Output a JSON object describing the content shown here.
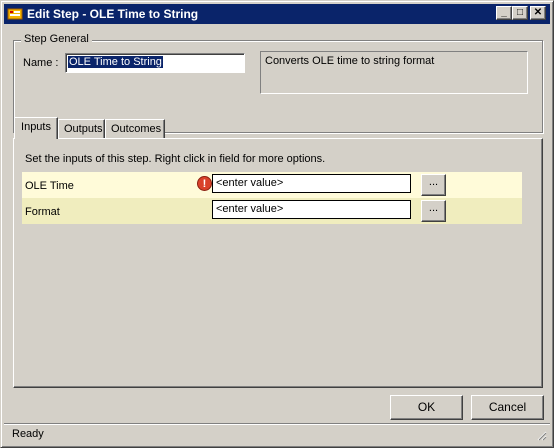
{
  "window": {
    "title": "Edit Step - OLE Time to String",
    "controls": {
      "minimize": "_",
      "maximize": "□",
      "close": "✕"
    }
  },
  "step_general": {
    "group_label": "Step General",
    "name_label": "Name :",
    "name_value": "OLE Time to String",
    "description": "Converts OLE time to string format"
  },
  "tabs": [
    {
      "label": "Inputs",
      "active": true
    },
    {
      "label": "Outputs",
      "active": false
    },
    {
      "label": "Outcomes",
      "active": false
    }
  ],
  "inputs_panel": {
    "instructions": "Set the inputs of this step.  Right click in field for more options.",
    "rows": [
      {
        "label": "OLE Time",
        "value": "<enter value>",
        "has_error": true,
        "browse": "..."
      },
      {
        "label": "Format",
        "value": "<enter value>",
        "has_error": false,
        "browse": "..."
      }
    ],
    "error_symbol": "!"
  },
  "buttons": {
    "ok": "OK",
    "cancel": "Cancel"
  },
  "status": {
    "text": "Ready"
  },
  "colors": {
    "title_bar": "#0a246a",
    "row_odd": "#fffbd9",
    "row_even": "#f0edbe",
    "error": "#d9412a",
    "face": "#d4d0c8"
  },
  "icons": {
    "app": "app-step-icon",
    "error": "error-icon",
    "grip": "resize-grip-icon"
  }
}
